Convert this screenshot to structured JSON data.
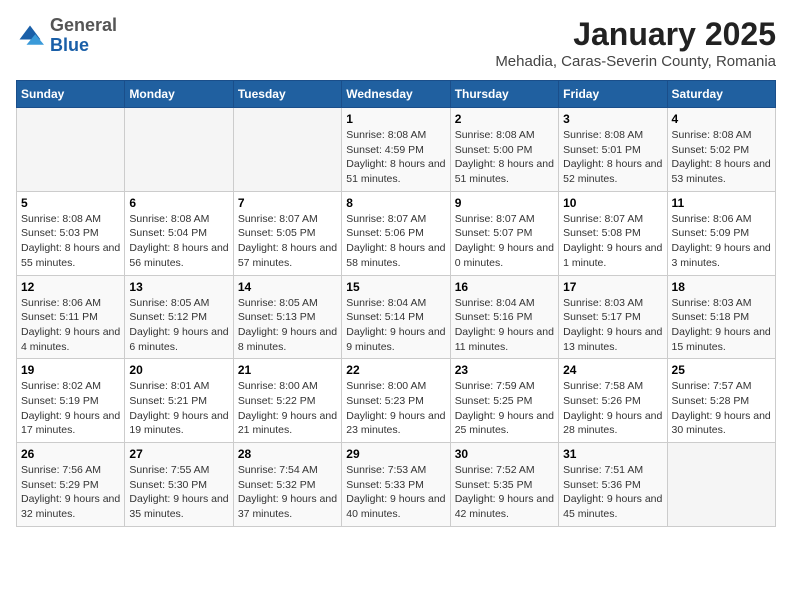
{
  "header": {
    "logo_general": "General",
    "logo_blue": "Blue",
    "title": "January 2025",
    "subtitle": "Mehadia, Caras-Severin County, Romania"
  },
  "weekdays": [
    "Sunday",
    "Monday",
    "Tuesday",
    "Wednesday",
    "Thursday",
    "Friday",
    "Saturday"
  ],
  "weeks": [
    [
      {
        "day": "",
        "info": ""
      },
      {
        "day": "",
        "info": ""
      },
      {
        "day": "",
        "info": ""
      },
      {
        "day": "1",
        "info": "Sunrise: 8:08 AM\nSunset: 4:59 PM\nDaylight: 8 hours and 51 minutes."
      },
      {
        "day": "2",
        "info": "Sunrise: 8:08 AM\nSunset: 5:00 PM\nDaylight: 8 hours and 51 minutes."
      },
      {
        "day": "3",
        "info": "Sunrise: 8:08 AM\nSunset: 5:01 PM\nDaylight: 8 hours and 52 minutes."
      },
      {
        "day": "4",
        "info": "Sunrise: 8:08 AM\nSunset: 5:02 PM\nDaylight: 8 hours and 53 minutes."
      }
    ],
    [
      {
        "day": "5",
        "info": "Sunrise: 8:08 AM\nSunset: 5:03 PM\nDaylight: 8 hours and 55 minutes."
      },
      {
        "day": "6",
        "info": "Sunrise: 8:08 AM\nSunset: 5:04 PM\nDaylight: 8 hours and 56 minutes."
      },
      {
        "day": "7",
        "info": "Sunrise: 8:07 AM\nSunset: 5:05 PM\nDaylight: 8 hours and 57 minutes."
      },
      {
        "day": "8",
        "info": "Sunrise: 8:07 AM\nSunset: 5:06 PM\nDaylight: 8 hours and 58 minutes."
      },
      {
        "day": "9",
        "info": "Sunrise: 8:07 AM\nSunset: 5:07 PM\nDaylight: 9 hours and 0 minutes."
      },
      {
        "day": "10",
        "info": "Sunrise: 8:07 AM\nSunset: 5:08 PM\nDaylight: 9 hours and 1 minute."
      },
      {
        "day": "11",
        "info": "Sunrise: 8:06 AM\nSunset: 5:09 PM\nDaylight: 9 hours and 3 minutes."
      }
    ],
    [
      {
        "day": "12",
        "info": "Sunrise: 8:06 AM\nSunset: 5:11 PM\nDaylight: 9 hours and 4 minutes."
      },
      {
        "day": "13",
        "info": "Sunrise: 8:05 AM\nSunset: 5:12 PM\nDaylight: 9 hours and 6 minutes."
      },
      {
        "day": "14",
        "info": "Sunrise: 8:05 AM\nSunset: 5:13 PM\nDaylight: 9 hours and 8 minutes."
      },
      {
        "day": "15",
        "info": "Sunrise: 8:04 AM\nSunset: 5:14 PM\nDaylight: 9 hours and 9 minutes."
      },
      {
        "day": "16",
        "info": "Sunrise: 8:04 AM\nSunset: 5:16 PM\nDaylight: 9 hours and 11 minutes."
      },
      {
        "day": "17",
        "info": "Sunrise: 8:03 AM\nSunset: 5:17 PM\nDaylight: 9 hours and 13 minutes."
      },
      {
        "day": "18",
        "info": "Sunrise: 8:03 AM\nSunset: 5:18 PM\nDaylight: 9 hours and 15 minutes."
      }
    ],
    [
      {
        "day": "19",
        "info": "Sunrise: 8:02 AM\nSunset: 5:19 PM\nDaylight: 9 hours and 17 minutes."
      },
      {
        "day": "20",
        "info": "Sunrise: 8:01 AM\nSunset: 5:21 PM\nDaylight: 9 hours and 19 minutes."
      },
      {
        "day": "21",
        "info": "Sunrise: 8:00 AM\nSunset: 5:22 PM\nDaylight: 9 hours and 21 minutes."
      },
      {
        "day": "22",
        "info": "Sunrise: 8:00 AM\nSunset: 5:23 PM\nDaylight: 9 hours and 23 minutes."
      },
      {
        "day": "23",
        "info": "Sunrise: 7:59 AM\nSunset: 5:25 PM\nDaylight: 9 hours and 25 minutes."
      },
      {
        "day": "24",
        "info": "Sunrise: 7:58 AM\nSunset: 5:26 PM\nDaylight: 9 hours and 28 minutes."
      },
      {
        "day": "25",
        "info": "Sunrise: 7:57 AM\nSunset: 5:28 PM\nDaylight: 9 hours and 30 minutes."
      }
    ],
    [
      {
        "day": "26",
        "info": "Sunrise: 7:56 AM\nSunset: 5:29 PM\nDaylight: 9 hours and 32 minutes."
      },
      {
        "day": "27",
        "info": "Sunrise: 7:55 AM\nSunset: 5:30 PM\nDaylight: 9 hours and 35 minutes."
      },
      {
        "day": "28",
        "info": "Sunrise: 7:54 AM\nSunset: 5:32 PM\nDaylight: 9 hours and 37 minutes."
      },
      {
        "day": "29",
        "info": "Sunrise: 7:53 AM\nSunset: 5:33 PM\nDaylight: 9 hours and 40 minutes."
      },
      {
        "day": "30",
        "info": "Sunrise: 7:52 AM\nSunset: 5:35 PM\nDaylight: 9 hours and 42 minutes."
      },
      {
        "day": "31",
        "info": "Sunrise: 7:51 AM\nSunset: 5:36 PM\nDaylight: 9 hours and 45 minutes."
      },
      {
        "day": "",
        "info": ""
      }
    ]
  ]
}
